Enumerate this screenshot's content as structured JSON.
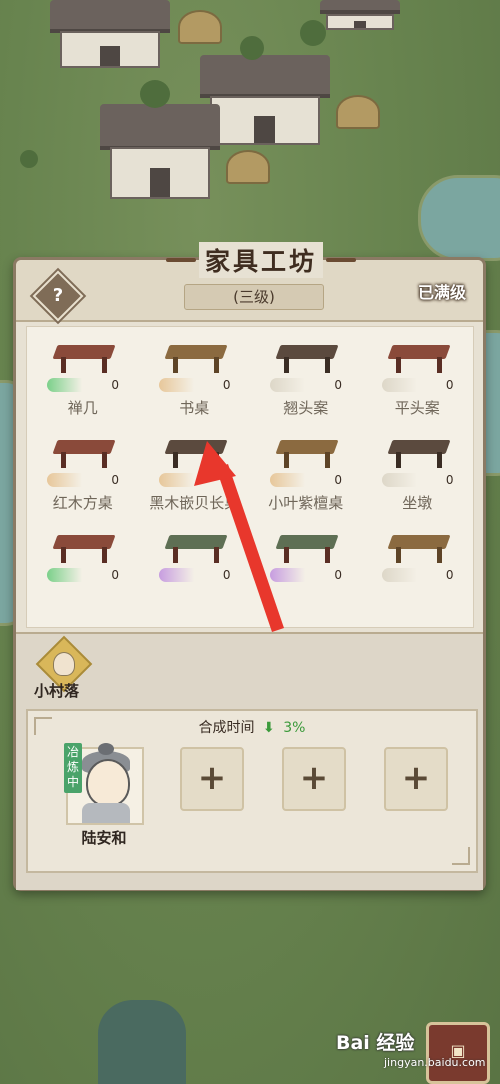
{
  "workshop": {
    "title": "家具工坊",
    "level": "(三级)",
    "help_symbol": "?",
    "maxed_label": "已满级"
  },
  "items": [
    {
      "name": "禅几",
      "count": "0",
      "style": "green"
    },
    {
      "name": "书桌",
      "count": "0",
      "style": "sand"
    },
    {
      "name": "翘头案",
      "count": "0",
      "style": "plain"
    },
    {
      "name": "平头案",
      "count": "0",
      "style": "plain"
    },
    {
      "name": "红木方桌",
      "count": "0",
      "style": "sand"
    },
    {
      "name": "黑木嵌贝长桌",
      "count": "0",
      "style": "sand"
    },
    {
      "name": "小叶紫檀桌",
      "count": "0",
      "style": "sand"
    },
    {
      "name": "坐墩",
      "count": "0",
      "style": "plain"
    },
    {
      "name": "",
      "count": "0",
      "style": "green"
    },
    {
      "name": "",
      "count": "0",
      "style": "purple"
    },
    {
      "name": "",
      "count": "0",
      "style": "purple"
    },
    {
      "name": "",
      "count": "0",
      "style": "plain"
    }
  ],
  "village": {
    "label": "小村落"
  },
  "crafting": {
    "time_label": "合成时间",
    "time_reduction": "3%",
    "worker_status": "冶炼中",
    "worker_name": "陆安和",
    "add_symbol": "+"
  },
  "watermark": {
    "text": "Bai 经验",
    "sub": "jingyan.baidu.com"
  },
  "colors": {
    "accent_green": "#3b9a3b",
    "annotation_arrow": "#e8372c",
    "panel_bg": "#e7e1d3"
  }
}
